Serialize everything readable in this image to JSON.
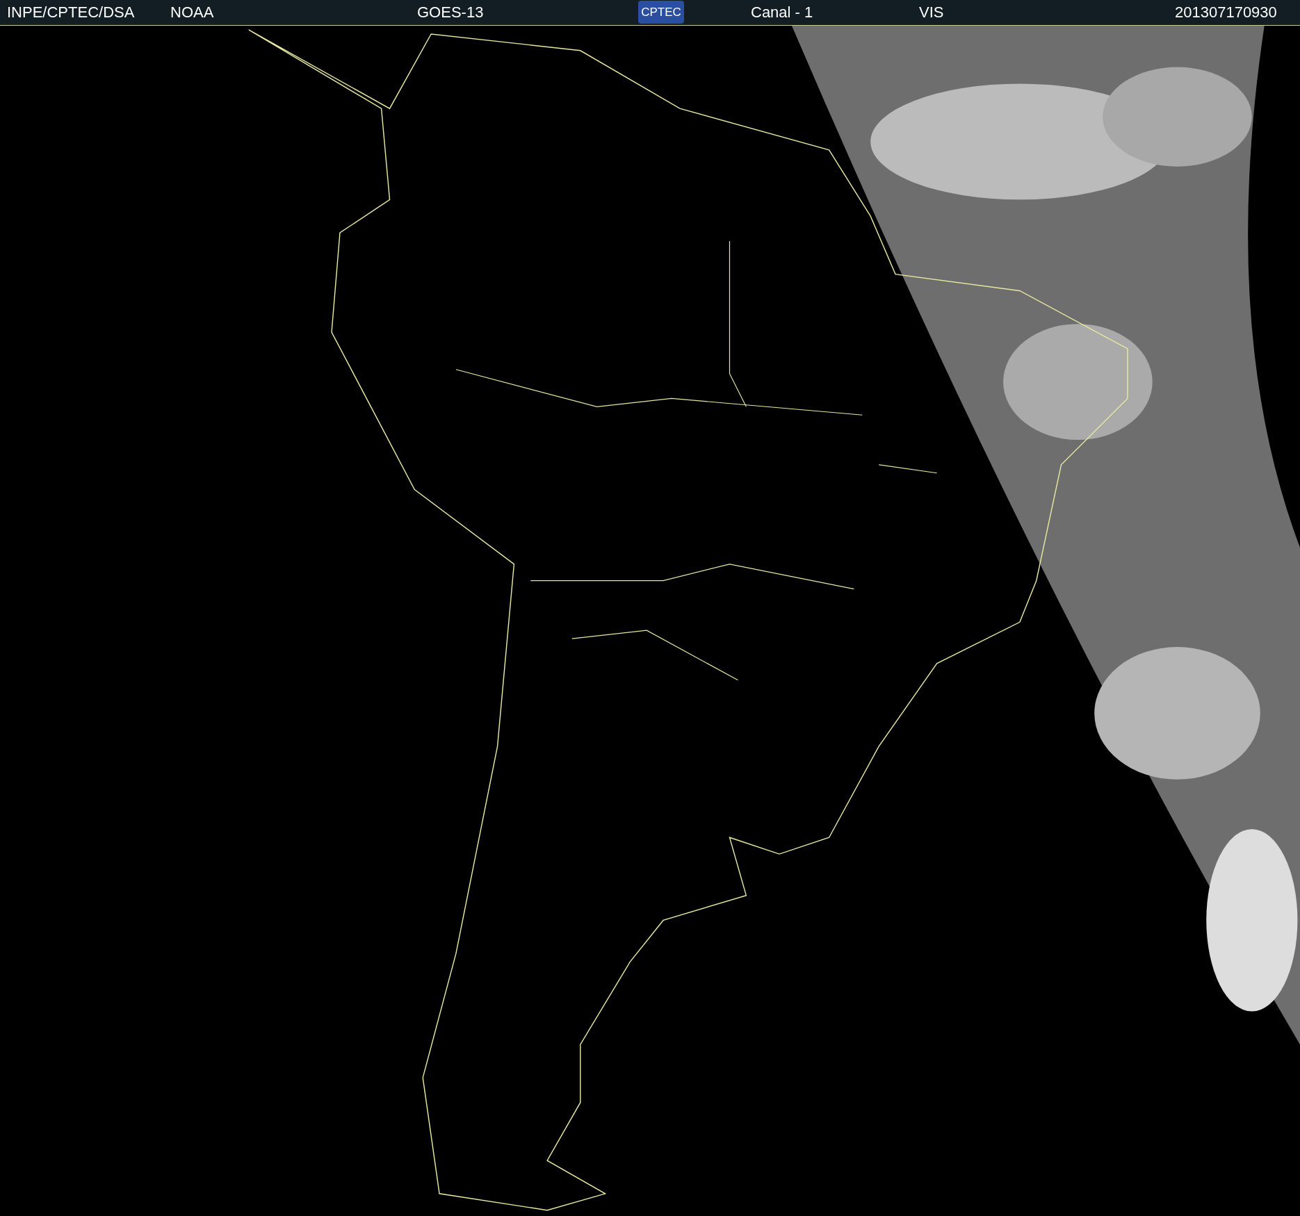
{
  "header": {
    "source": "INPE/CPTEC/DSA",
    "agency": "NOAA",
    "satellite": "GOES-13",
    "logo": "CPTEC",
    "channel": "Canal - 1",
    "band": "VIS",
    "timestamp": "201307170930"
  }
}
